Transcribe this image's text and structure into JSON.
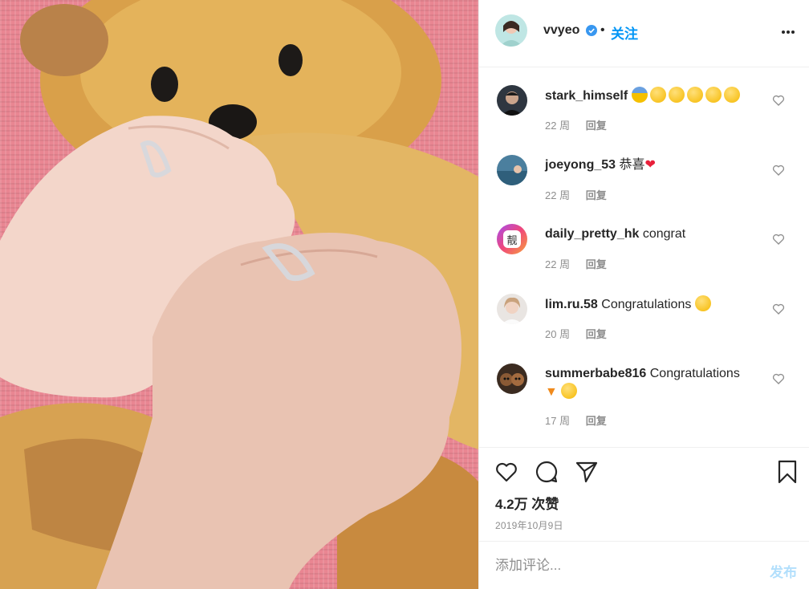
{
  "post": {
    "author": {
      "username": "vvyeo",
      "verified": true,
      "follow_label": "关注",
      "separator": "•",
      "avatar_icon": "avatar-photo"
    },
    "image": {
      "subject": "two hands with rings over a cross-stitch teddy bear on pink background",
      "colors": {
        "pink": "#e98692",
        "bear": "#d9a04a",
        "skin": "#f2d2c4"
      }
    }
  },
  "comments": [
    {
      "username": "stark_himself",
      "text": "",
      "emojis": [
        "😨",
        "😣",
        "😥",
        "😫",
        "😭",
        "😤"
      ],
      "time": "22 周",
      "reply_label": "回复"
    },
    {
      "username": "joeyong_53",
      "text": "恭喜",
      "emojis_after": [
        "❤️"
      ],
      "time": "22 周",
      "reply_label": "回复"
    },
    {
      "username": "daily_pretty_hk",
      "text": "congrat",
      "avatar_label": "靓",
      "time": "22 周",
      "reply_label": "回复"
    },
    {
      "username": "lim.ru.58",
      "text": "Congratulations",
      "emojis_after": [
        "🎉"
      ],
      "time": "20 周",
      "reply_label": "回复"
    },
    {
      "username": "summerbabe816",
      "text": "Congratulations",
      "emojis_after": [
        "🥕",
        "🎉"
      ],
      "time": "17 周",
      "reply_label": "回复"
    }
  ],
  "actions": {
    "icons": [
      "heart-icon",
      "comment-icon",
      "share-icon",
      "bookmark-icon"
    ],
    "likes_label": "4.2万 次赞",
    "date_label": "2019年10月9日"
  },
  "composer": {
    "placeholder": "添加评论...",
    "post_label": "发布",
    "post_color": "#b2dffc"
  },
  "accent_color": "#0095f6"
}
